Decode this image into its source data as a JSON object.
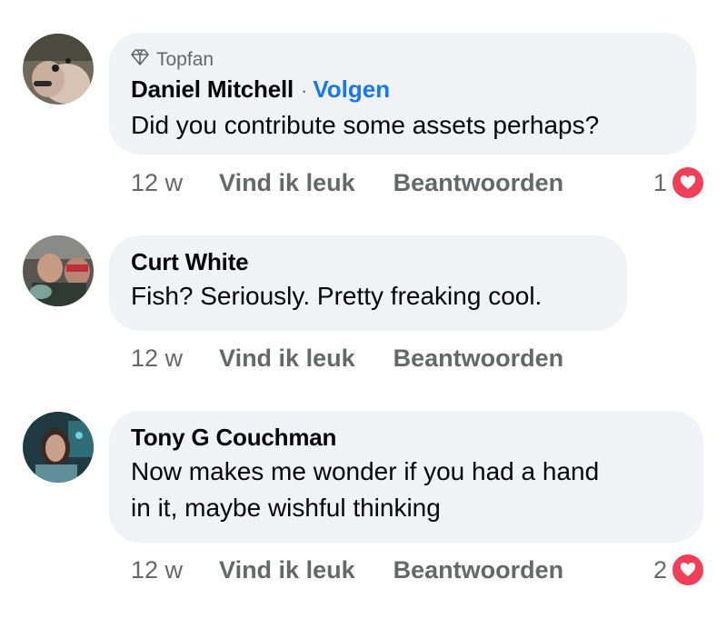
{
  "comments": [
    {
      "badge": "Topfan",
      "author": "Daniel Mitchell",
      "separator": "·",
      "follow": "Volgen",
      "text_lines": [
        "Did you contribute some assets perhaps?"
      ],
      "time": "12 w",
      "like_label": "Vind ik leuk",
      "reply_label": "Beantwoorden",
      "reaction_count": "1",
      "reaction_icon": "heart-icon"
    },
    {
      "author": "Curt White",
      "text_lines": [
        "Fish? Seriously. Pretty freaking cool."
      ],
      "time": "12 w",
      "like_label": "Vind ik leuk",
      "reply_label": "Beantwoorden"
    },
    {
      "author": "Tony G Couchman",
      "text_lines": [
        "Now makes me wonder if you had a hand",
        "in it, maybe wishful thinking"
      ],
      "time": "12 w",
      "like_label": "Vind ik leuk",
      "reply_label": "Beantwoorden",
      "reaction_count": "2",
      "reaction_icon": "heart-icon"
    }
  ],
  "colors": {
    "bubble": "#f0f2f5",
    "link": "#1877f2",
    "muted": "#65676b",
    "heart": "#f33e58"
  }
}
